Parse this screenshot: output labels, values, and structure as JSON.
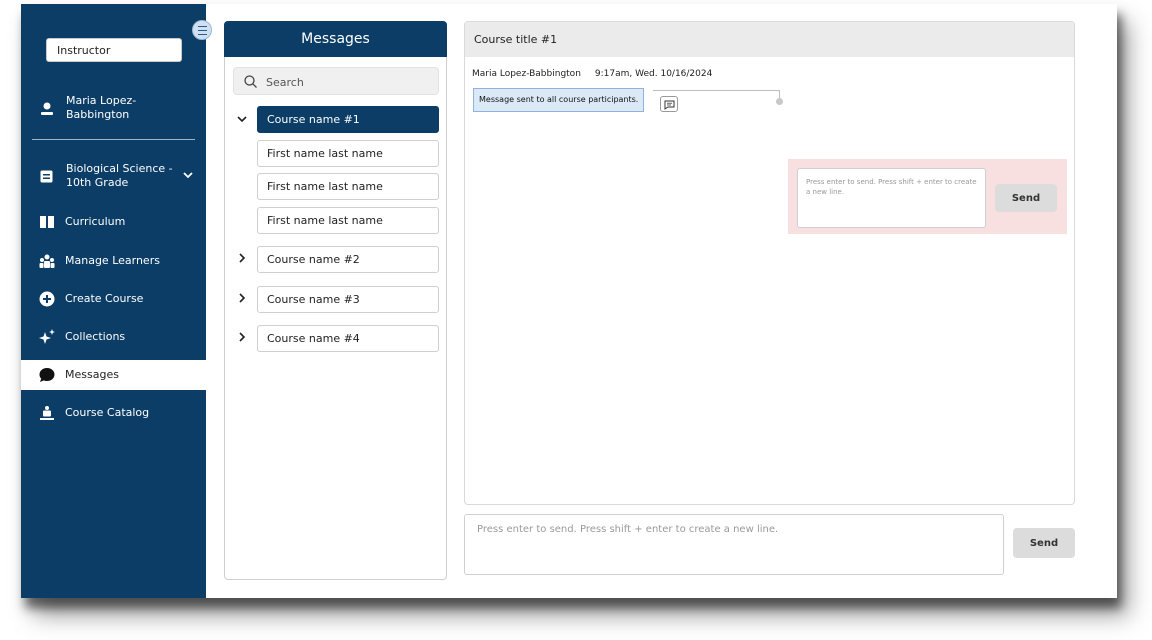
{
  "sidebar": {
    "role": "Instructor",
    "user_name": "Maria Lopez-\nBabbington",
    "course_selector": "Biological Science -\n10th Grade",
    "nav": [
      {
        "label": "Curriculum",
        "icon": "book-icon"
      },
      {
        "label": "Manage Learners",
        "icon": "learners-icon"
      },
      {
        "label": "Create Course",
        "icon": "plus-circle-icon"
      },
      {
        "label": "Collections",
        "icon": "sparkle-icon"
      },
      {
        "label": "Messages",
        "icon": "chat-bubble-icon",
        "active": true
      },
      {
        "label": "Course Catalog",
        "icon": "catalog-icon"
      }
    ]
  },
  "messages_panel": {
    "title": "Messages",
    "search_placeholder": "Search",
    "courses": [
      {
        "label": "Course name #1",
        "expanded": true,
        "selected": true,
        "participants": [
          "First name last name",
          "First name last name",
          "First name last name"
        ]
      },
      {
        "label": "Course name #2",
        "expanded": false
      },
      {
        "label": "Course name #3",
        "expanded": false
      },
      {
        "label": "Course name #4",
        "expanded": false
      }
    ]
  },
  "conversation": {
    "title": "Course title #1",
    "messages": [
      {
        "author": "Maria Lopez-Babbington",
        "time": "9:17am, Wed. 10/16/2024",
        "text": "Message sent to all course participants."
      }
    ],
    "reply": {
      "placeholder": "Press enter to send. Press shift + enter to create a new line.",
      "send_label": "Send"
    }
  },
  "composer": {
    "placeholder": "Press enter to send. Press shift + enter to create a new line.",
    "send_label": "Send"
  },
  "colors": {
    "brand_navy": "#0b3d66",
    "bubble_fill": "#dbe9f7",
    "reply_highlight": "#f8e0e0"
  }
}
